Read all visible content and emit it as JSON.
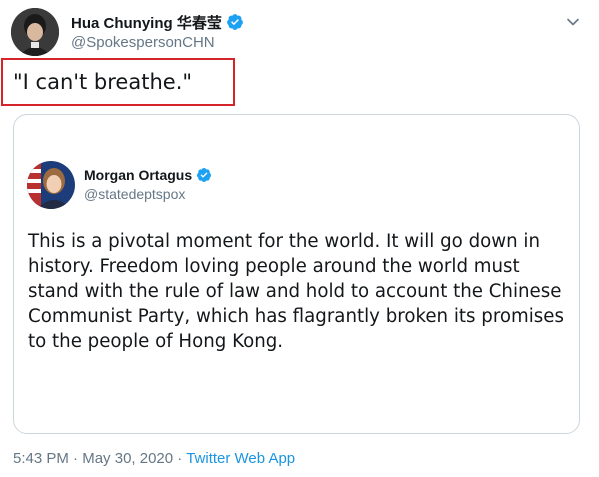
{
  "tweet": {
    "author": {
      "display_name": "Hua Chunying 华春莹",
      "handle": "@SpokespersonCHN",
      "verified": true,
      "avatar_icon": "profile-photo"
    },
    "text": "\"I can't breathe.\"",
    "highlight_color": "#d6242b",
    "menu_icon": "chevron-down-icon",
    "quoted_tweet": {
      "author": {
        "display_name": "Morgan Ortagus",
        "handle": "@statedeptspox",
        "verified": true,
        "avatar_icon": "profile-photo"
      },
      "text": "This is a pivotal moment for the world. It will go down in history. Freedom loving people around the world must stand with the rule of law and hold to account the Chinese Communist Party, which has flagrantly broken its promises to the people of Hong Kong."
    },
    "meta": {
      "time": "5:43 PM",
      "separator": " · ",
      "date": "May 30, 2020",
      "source": "Twitter Web App"
    }
  },
  "colors": {
    "text_primary": "#14171a",
    "text_secondary": "#657786",
    "verified_blue": "#1da1f2",
    "link_blue": "#1b95e0",
    "card_border": "#ccd6dd"
  }
}
